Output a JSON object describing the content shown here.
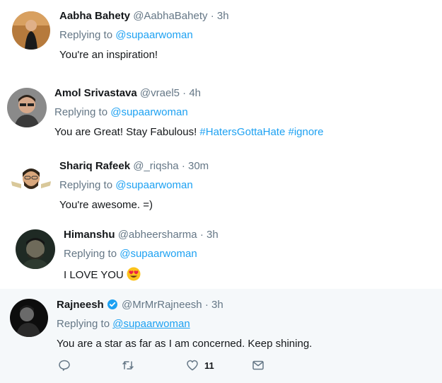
{
  "replies": [
    {
      "name": "Aabha Bahety",
      "handle": "@AabhaBahety",
      "time": "3h",
      "replying_prefix": "Replying to",
      "replying_to": "@supaarwoman",
      "text": "You're an inspiration!"
    },
    {
      "name": "Amol Srivastava",
      "handle": "@vrael5",
      "time": "4h",
      "replying_prefix": "Replying to",
      "replying_to": "@supaarwoman",
      "text": "You are Great! Stay Fabulous!",
      "hashtags": [
        "#HatersGottaHate",
        "#ignore"
      ]
    },
    {
      "name": "Shariq Rafeek",
      "handle": "@_riqsha",
      "time": "30m",
      "replying_prefix": "Replying to",
      "replying_to": "@supaarwoman",
      "text": "You're awesome. =)"
    },
    {
      "name": "Himanshu",
      "handle": "@abheersharma",
      "time": "3h",
      "replying_prefix": "Replying to",
      "replying_to": "@supaarwoman",
      "text": "I LOVE YOU",
      "emoji": "heart-eyes-emoji"
    },
    {
      "name": "Rajneesh",
      "handle": "@MrMrRajneesh",
      "time": "3h",
      "verified": true,
      "replying_prefix": "Replying to",
      "replying_to": "@supaarwoman",
      "text": "You are a star as far as I am concerned. Keep shining."
    }
  ],
  "actions": {
    "reply_icon": "reply-icon",
    "retweet_icon": "retweet-icon",
    "like_icon": "heart-icon",
    "like_count": "11",
    "dm_icon": "envelope-icon"
  },
  "colors": {
    "link": "#1da1f2",
    "muted": "#657786",
    "text": "#14171a",
    "highlight_bg": "#f5f8fa"
  }
}
